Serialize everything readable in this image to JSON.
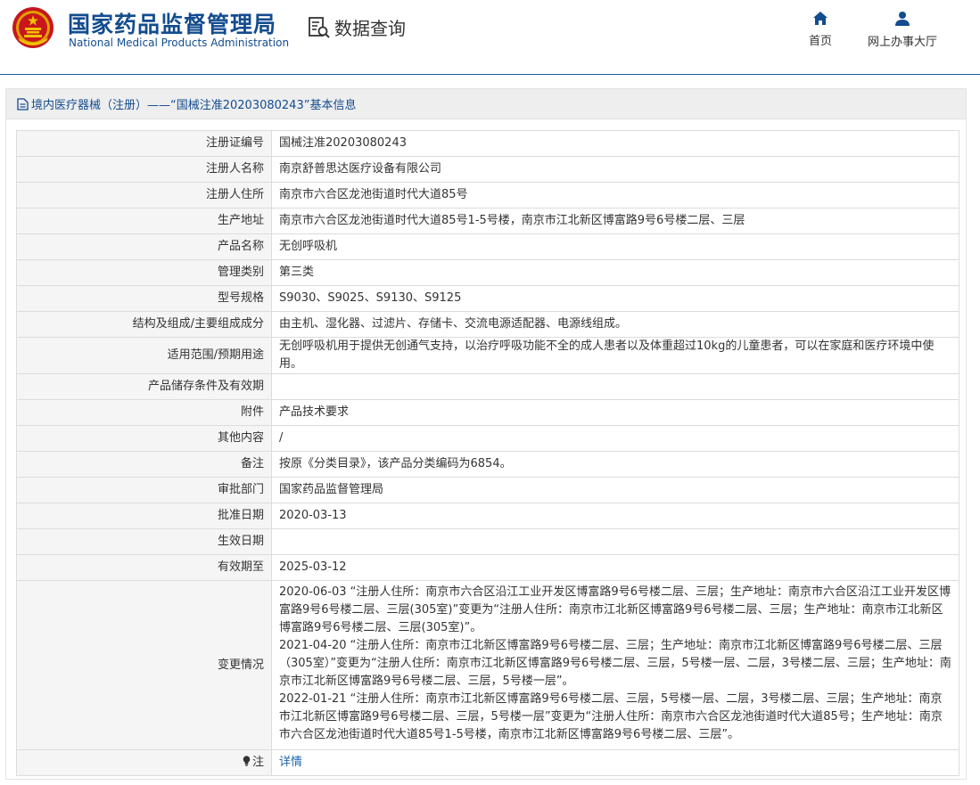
{
  "header": {
    "brand_cn": "国家药品监督管理局",
    "brand_en": "National Medical Products Administration",
    "query_label": "数据查询",
    "nav": [
      {
        "label": "首页",
        "icon": "home-icon"
      },
      {
        "label": "网上办事大厅",
        "icon": "user-icon"
      }
    ]
  },
  "colors": {
    "brand_blue": "#134c8f",
    "link_blue": "#1a64b0",
    "label_bg": "#f5f5f5"
  },
  "panel": {
    "title": "境内医疗器械（注册）——“国械注准20203080243”基本信息"
  },
  "rows": [
    {
      "label": "注册证编号",
      "value": "国械注准20203080243"
    },
    {
      "label": "注册人名称",
      "value": "南京舒普思达医疗设备有限公司"
    },
    {
      "label": "注册人住所",
      "value": "南京市六合区龙池街道时代大道85号"
    },
    {
      "label": "生产地址",
      "value": "南京市六合区龙池街道时代大道85号1-5号楼，南京市江北新区博富路9号6号楼二层、三层"
    },
    {
      "label": "产品名称",
      "value": "无创呼吸机"
    },
    {
      "label": "管理类别",
      "value": "第三类"
    },
    {
      "label": "型号规格",
      "value": "S9030、S9025、S9130、S9125"
    },
    {
      "label": "结构及组成/主要组成成分",
      "value": "由主机、湿化器、过滤片、存储卡、交流电源适配器、电源线组成。"
    },
    {
      "label": "适用范围/预期用途",
      "value": "无创呼吸机用于提供无创通气支持，以治疗呼吸功能不全的成人患者以及体重超过10kg的儿童患者，可以在家庭和医疗环境中使用。"
    },
    {
      "label": "产品储存条件及有效期",
      "value": ""
    },
    {
      "label": "附件",
      "value": "产品技术要求"
    },
    {
      "label": "其他内容",
      "value": "/"
    },
    {
      "label": "备注",
      "value": "按原《分类目录》，该产品分类编码为6854。"
    },
    {
      "label": "审批部门",
      "value": "国家药品监督管理局"
    },
    {
      "label": "批准日期",
      "value": "2020-03-13"
    },
    {
      "label": "生效日期",
      "value": ""
    },
    {
      "label": "有效期至",
      "value": "2025-03-12"
    }
  ],
  "changes": {
    "label": "变更情况",
    "entries": [
      "2020-06-03 “注册人住所：南京市六合区沿江工业开发区博富路9号6号楼二层、三层；生产地址：南京市六合区沿江工业开发区博富路9号6号楼二层、三层(305室)”变更为“注册人住所：南京市江北新区博富路9号6号楼二层、三层；生产地址：南京市江北新区博富路9号6号楼二层、三层(305室)”。",
      "2021-04-20 “注册人住所：南京市江北新区博富路9号6号楼二层、三层；生产地址：南京市江北新区博富路9号6号楼二层、三层（305室）”变更为“注册人住所：南京市江北新区博富路9号6号楼二层、三层，5号楼一层、二层，3号楼二层、三层；生产地址：南京市江北新区博富路9号6号楼二层、三层，5号楼一层”。",
      "2022-01-21 “注册人住所：南京市江北新区博富路9号6号楼二层、三层，5号楼一层、二层，3号楼二层、三层；生产地址：南京市江北新区博富路9号6号楼二层、三层，5号楼一层”变更为“注册人住所：南京市六合区龙池街道时代大道85号；生产地址：南京市六合区龙池街道时代大道85号1-5号楼，南京市江北新区博富路9号6号楼二层、三层”。"
    ]
  },
  "note": {
    "label": "注",
    "icon": "lightbulb-icon",
    "link_label": "详情"
  }
}
